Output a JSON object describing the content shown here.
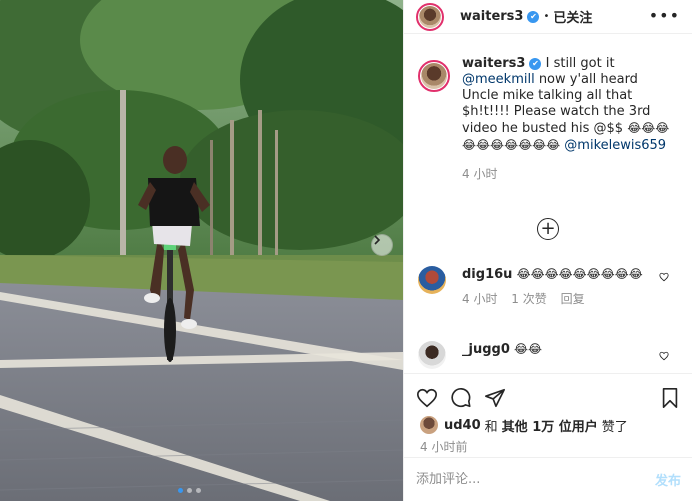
{
  "post": {
    "author": "waiters3",
    "header_dot": "•",
    "follow_status": "已关注",
    "more_glyph": "•••",
    "verified_glyph": "✔"
  },
  "caption": {
    "author": "waiters3",
    "text_1": "I still got it",
    "mention_1": "@meekmill",
    "text_2": " now y'all heard Uncle mike talking all that $h!t!!!! Please watch the 3rd video he busted his @$$ ",
    "emoji_run": "😂😂😂😂😂😂😂😂😂😂",
    "mention_2": "@mikelewis659",
    "time": "4 小时"
  },
  "load_more_glyph": "+",
  "comments": [
    {
      "user": "dig16u",
      "emojis": "😂😂😂😂😂😂😂😂😂",
      "time": "4 小时",
      "likes": "1 次赞",
      "reply": "回复"
    },
    {
      "user": "_jugg0",
      "emojis": "😂😂"
    }
  ],
  "likes": {
    "user": "ud40",
    "connector": "和",
    "others": "其他 1万 位用户",
    "suffix": "赞了"
  },
  "posted_ago": "4 小时前",
  "add_comment": {
    "placeholder": "添加评论...",
    "post_label": "发布"
  },
  "carousel": {
    "slides": 3,
    "active": 0
  }
}
